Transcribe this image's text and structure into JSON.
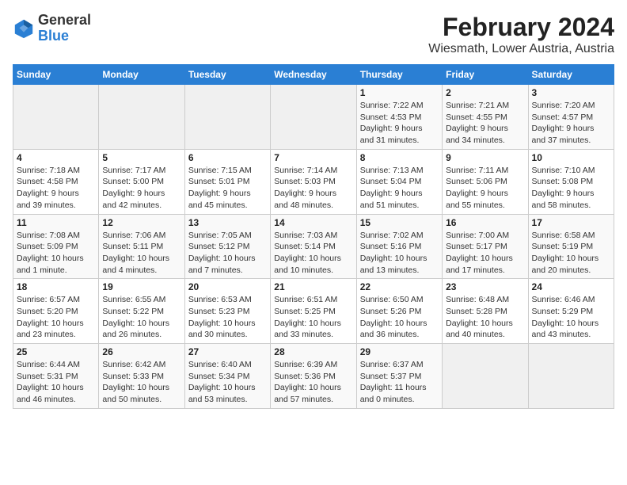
{
  "header": {
    "logo_line1": "General",
    "logo_line2": "Blue",
    "title": "February 2024",
    "subtitle": "Wiesmath, Lower Austria, Austria"
  },
  "calendar": {
    "weekdays": [
      "Sunday",
      "Monday",
      "Tuesday",
      "Wednesday",
      "Thursday",
      "Friday",
      "Saturday"
    ],
    "weeks": [
      [
        {
          "day": "",
          "info": ""
        },
        {
          "day": "",
          "info": ""
        },
        {
          "day": "",
          "info": ""
        },
        {
          "day": "",
          "info": ""
        },
        {
          "day": "1",
          "info": "Sunrise: 7:22 AM\nSunset: 4:53 PM\nDaylight: 9 hours\nand 31 minutes."
        },
        {
          "day": "2",
          "info": "Sunrise: 7:21 AM\nSunset: 4:55 PM\nDaylight: 9 hours\nand 34 minutes."
        },
        {
          "day": "3",
          "info": "Sunrise: 7:20 AM\nSunset: 4:57 PM\nDaylight: 9 hours\nand 37 minutes."
        }
      ],
      [
        {
          "day": "4",
          "info": "Sunrise: 7:18 AM\nSunset: 4:58 PM\nDaylight: 9 hours\nand 39 minutes."
        },
        {
          "day": "5",
          "info": "Sunrise: 7:17 AM\nSunset: 5:00 PM\nDaylight: 9 hours\nand 42 minutes."
        },
        {
          "day": "6",
          "info": "Sunrise: 7:15 AM\nSunset: 5:01 PM\nDaylight: 9 hours\nand 45 minutes."
        },
        {
          "day": "7",
          "info": "Sunrise: 7:14 AM\nSunset: 5:03 PM\nDaylight: 9 hours\nand 48 minutes."
        },
        {
          "day": "8",
          "info": "Sunrise: 7:13 AM\nSunset: 5:04 PM\nDaylight: 9 hours\nand 51 minutes."
        },
        {
          "day": "9",
          "info": "Sunrise: 7:11 AM\nSunset: 5:06 PM\nDaylight: 9 hours\nand 55 minutes."
        },
        {
          "day": "10",
          "info": "Sunrise: 7:10 AM\nSunset: 5:08 PM\nDaylight: 9 hours\nand 58 minutes."
        }
      ],
      [
        {
          "day": "11",
          "info": "Sunrise: 7:08 AM\nSunset: 5:09 PM\nDaylight: 10 hours\nand 1 minute."
        },
        {
          "day": "12",
          "info": "Sunrise: 7:06 AM\nSunset: 5:11 PM\nDaylight: 10 hours\nand 4 minutes."
        },
        {
          "day": "13",
          "info": "Sunrise: 7:05 AM\nSunset: 5:12 PM\nDaylight: 10 hours\nand 7 minutes."
        },
        {
          "day": "14",
          "info": "Sunrise: 7:03 AM\nSunset: 5:14 PM\nDaylight: 10 hours\nand 10 minutes."
        },
        {
          "day": "15",
          "info": "Sunrise: 7:02 AM\nSunset: 5:16 PM\nDaylight: 10 hours\nand 13 minutes."
        },
        {
          "day": "16",
          "info": "Sunrise: 7:00 AM\nSunset: 5:17 PM\nDaylight: 10 hours\nand 17 minutes."
        },
        {
          "day": "17",
          "info": "Sunrise: 6:58 AM\nSunset: 5:19 PM\nDaylight: 10 hours\nand 20 minutes."
        }
      ],
      [
        {
          "day": "18",
          "info": "Sunrise: 6:57 AM\nSunset: 5:20 PM\nDaylight: 10 hours\nand 23 minutes."
        },
        {
          "day": "19",
          "info": "Sunrise: 6:55 AM\nSunset: 5:22 PM\nDaylight: 10 hours\nand 26 minutes."
        },
        {
          "day": "20",
          "info": "Sunrise: 6:53 AM\nSunset: 5:23 PM\nDaylight: 10 hours\nand 30 minutes."
        },
        {
          "day": "21",
          "info": "Sunrise: 6:51 AM\nSunset: 5:25 PM\nDaylight: 10 hours\nand 33 minutes."
        },
        {
          "day": "22",
          "info": "Sunrise: 6:50 AM\nSunset: 5:26 PM\nDaylight: 10 hours\nand 36 minutes."
        },
        {
          "day": "23",
          "info": "Sunrise: 6:48 AM\nSunset: 5:28 PM\nDaylight: 10 hours\nand 40 minutes."
        },
        {
          "day": "24",
          "info": "Sunrise: 6:46 AM\nSunset: 5:29 PM\nDaylight: 10 hours\nand 43 minutes."
        }
      ],
      [
        {
          "day": "25",
          "info": "Sunrise: 6:44 AM\nSunset: 5:31 PM\nDaylight: 10 hours\nand 46 minutes."
        },
        {
          "day": "26",
          "info": "Sunrise: 6:42 AM\nSunset: 5:33 PM\nDaylight: 10 hours\nand 50 minutes."
        },
        {
          "day": "27",
          "info": "Sunrise: 6:40 AM\nSunset: 5:34 PM\nDaylight: 10 hours\nand 53 minutes."
        },
        {
          "day": "28",
          "info": "Sunrise: 6:39 AM\nSunset: 5:36 PM\nDaylight: 10 hours\nand 57 minutes."
        },
        {
          "day": "29",
          "info": "Sunrise: 6:37 AM\nSunset: 5:37 PM\nDaylight: 11 hours\nand 0 minutes."
        },
        {
          "day": "",
          "info": ""
        },
        {
          "day": "",
          "info": ""
        }
      ]
    ]
  }
}
